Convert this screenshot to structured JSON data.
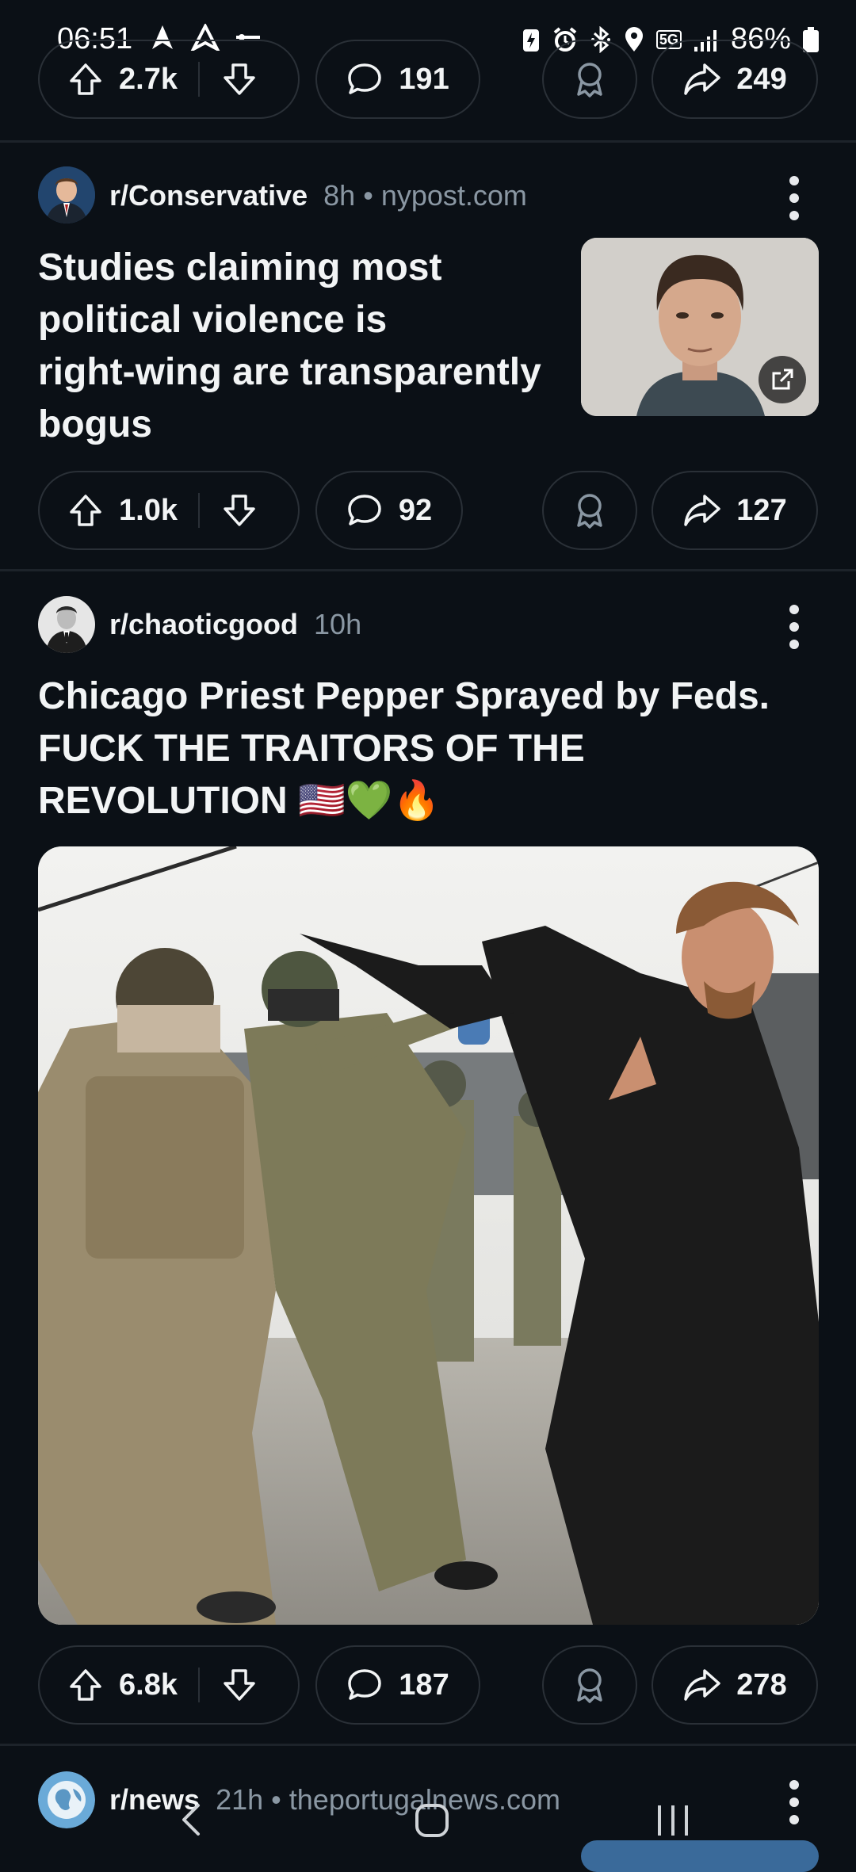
{
  "status_bar": {
    "time": "06:51",
    "battery": "86%",
    "network": "5G",
    "icons_left": [
      "navigation-arrow-icon",
      "navigation-outline-icon",
      "minus-icon"
    ],
    "icons_right": [
      "battery-saver-icon",
      "alarm-icon",
      "bluetooth-icon",
      "location-icon",
      "5g-icon",
      "signal-icon",
      "battery-icon"
    ]
  },
  "top_actions": {
    "upvotes": "2.7k",
    "comments": "191",
    "shares": "249"
  },
  "posts": [
    {
      "subreddit": "r/Conservative",
      "age": "8h",
      "separator": "•",
      "domain": "nypost.com",
      "title": "Studies claiming most political violence is right-wing are transparently bogus",
      "title_lines": [
        "Studies claiming most",
        "political violence is",
        "right-wing are transparently",
        "bogus"
      ],
      "upvotes": "1.0k",
      "comments": "92",
      "shares": "127"
    },
    {
      "subreddit": "r/chaoticgood",
      "age": "10h",
      "title_lines": [
        "Chicago Priest Pepper Sprayed by Feds.",
        "FUCK THE TRAITORS OF THE",
        "REVOLUTION 🇺🇸💚🔥"
      ],
      "upvotes": "6.8k",
      "comments": "187",
      "shares": "278"
    },
    {
      "subreddit": "r/news",
      "age": "21h",
      "separator": "•",
      "domain": "theportugalnews.com"
    }
  ],
  "colors": {
    "background": "#0b1016",
    "pill_border": "#2a3037",
    "meta_text": "#8a97a3",
    "divider": "#1d232a"
  }
}
